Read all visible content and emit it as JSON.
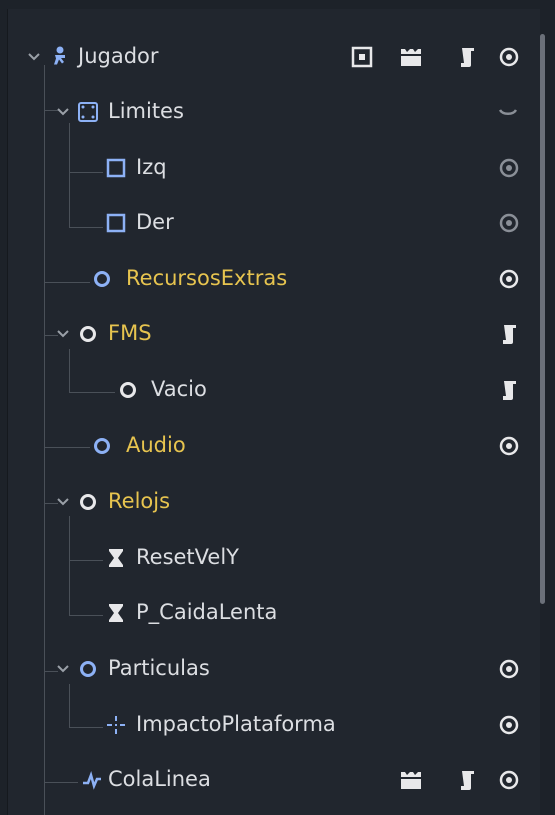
{
  "colors": {
    "background": "#21262e",
    "text": "#dcdee2",
    "highlight_text": "#e7c44f",
    "node_blue": "#8db1f5",
    "node_green": "#8ed476",
    "guide_line": "#4a5058"
  },
  "nodes": [
    {
      "label": "Jugador",
      "icon": "character-body-icon",
      "expanded": true,
      "highlight": false,
      "actions": [
        "canvas-layer-icon",
        "clapperboard-icon",
        "script-icon",
        "visibility-eye-icon"
      ]
    },
    {
      "label": "Limites",
      "icon": "area-2d-icon",
      "expanded": true,
      "highlight": false,
      "actions": [
        "visibility-collapsed-icon"
      ]
    },
    {
      "label": "Izq",
      "icon": "collision-shape-icon",
      "highlight": false,
      "actions": [
        "visibility-eye-icon"
      ]
    },
    {
      "label": "Der",
      "icon": "collision-shape-icon",
      "highlight": false,
      "actions": [
        "visibility-eye-icon"
      ]
    },
    {
      "label": "RecursosExtras",
      "icon": "node-circle-icon",
      "highlight": true,
      "actions": [
        "visibility-eye-icon"
      ]
    },
    {
      "label": "FMS",
      "icon": "node-circle-icon",
      "expanded": true,
      "highlight": true,
      "actions": [
        "script-icon"
      ]
    },
    {
      "label": "Vacio",
      "icon": "node-circle-icon",
      "highlight": false,
      "actions": [
        "script-icon"
      ]
    },
    {
      "label": "Audio",
      "icon": "node-circle-icon",
      "highlight": true,
      "actions": [
        "visibility-eye-icon"
      ]
    },
    {
      "label": "Relojs",
      "icon": "node-circle-icon",
      "expanded": true,
      "highlight": true,
      "actions": []
    },
    {
      "label": "ResetVelY",
      "icon": "timer-hourglass-icon",
      "highlight": false,
      "actions": []
    },
    {
      "label": "P_CaidaLenta",
      "icon": "timer-hourglass-icon",
      "highlight": false,
      "actions": []
    },
    {
      "label": "Particulas",
      "icon": "node-circle-icon",
      "expanded": true,
      "highlight": false,
      "actions": [
        "visibility-eye-icon"
      ]
    },
    {
      "label": "ImpactoPlataforma",
      "icon": "particles-icon",
      "highlight": false,
      "actions": [
        "visibility-eye-icon"
      ]
    },
    {
      "label": "ColaLinea",
      "icon": "line-2d-icon",
      "highlight": false,
      "actions": [
        "clapperboard-icon",
        "script-icon",
        "visibility-eye-icon"
      ]
    }
  ]
}
